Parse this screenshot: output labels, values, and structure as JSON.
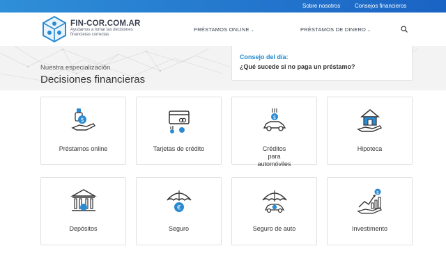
{
  "topbar": {
    "links": [
      "Sobre nosotros",
      "Consejos financieros"
    ]
  },
  "header": {
    "brand": "FIN-COR.COM.AR",
    "tagline": "Ayudamos a tomar las decisiones financieras correctas",
    "nav": [
      {
        "label": "PRÉSTAMOS ONLINE"
      },
      {
        "label": "PRÉSTAMOS DE DINERO"
      }
    ]
  },
  "hero": {
    "subtitle": "Nuestra especialización",
    "title": "Decisiones financieras",
    "tip": {
      "label": "Consejo del día:",
      "question": "¿Qué sucede si no paga un préstamo?"
    }
  },
  "categories": [
    {
      "label": "Préstamos online",
      "icon": "hand-coin-icon"
    },
    {
      "label": "Tarjetas de crédito",
      "icon": "credit-card-icon"
    },
    {
      "label": "Créditos para automóviles",
      "icon": "car-coin-icon"
    },
    {
      "label": "Hipoteca",
      "icon": "house-hand-icon"
    },
    {
      "label": "Depósitos",
      "icon": "bank-icon"
    },
    {
      "label": "Seguro",
      "icon": "umbrella-euro-icon"
    },
    {
      "label": "Seguro de auto",
      "icon": "umbrella-car-icon"
    },
    {
      "label": "Investimento",
      "icon": "growth-chart-icon"
    }
  ],
  "colors": {
    "accent": "#1f88cf",
    "topbar": "#1a63c4",
    "hero_bg": "#f3f3f3"
  }
}
